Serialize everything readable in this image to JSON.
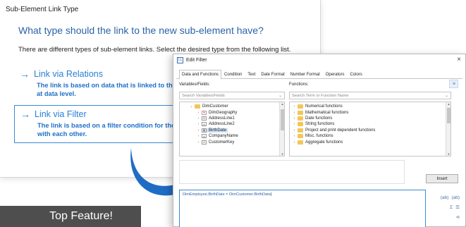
{
  "back_dialog": {
    "title": "Sub-Element Link Type",
    "question": "What type should the link to the new sub-element have?",
    "description": "There are different types of sub-element links. Select the desired type from the following list.",
    "options": [
      {
        "label": "Link via Relations",
        "sub": "The link is based on data that is linked to th",
        "sub2": "at data level."
      },
      {
        "label": "Link via Filter",
        "sub": "The link is based on a filter condition for the",
        "sub2": "with each other."
      }
    ]
  },
  "banner": {
    "text": "Top Feature!"
  },
  "edit_filter": {
    "title": "Edit Filter",
    "close": "×",
    "tabs": [
      "Data and Functions",
      "Condition",
      "Text",
      "Date Format",
      "Number Format",
      "Operators",
      "Colors"
    ],
    "variables_label": "Variables/Fields:",
    "functions_label": "Functions:",
    "search_variables_placeholder": "Search Variables/Fields",
    "search_functions_placeholder": "Search Term or Function Name",
    "variables": [
      {
        "label": "DimCustomer",
        "type": "folder",
        "expanded": true
      },
      {
        "label": "DimGeography",
        "type": "table"
      },
      {
        "label": "AddressLine1",
        "type": "text"
      },
      {
        "label": "AddressLine2",
        "type": "text"
      },
      {
        "label": "BirthDate",
        "type": "date",
        "selected": true
      },
      {
        "label": "CompanyName",
        "type": "text"
      },
      {
        "label": "CustomerKey",
        "type": "number"
      }
    ],
    "functions": [
      "Numerical functions",
      "Mathematical functions",
      "Date functions",
      "String functions",
      "Project and print dependent functions",
      "Misc. functions",
      "Aggregate functions"
    ],
    "insert_label": "Insert",
    "expression": "DimEmployee.BirthDate = DimCustomer.BirthDate",
    "side_icons": [
      "(ab)",
      "(ab)",
      "Σ",
      "☰",
      "⊲"
    ]
  },
  "colors": {
    "accent": "#2a7fd4",
    "selection": "#cde1f7",
    "banner": "#4e4e4e",
    "arrow": "#1f6cc4"
  }
}
